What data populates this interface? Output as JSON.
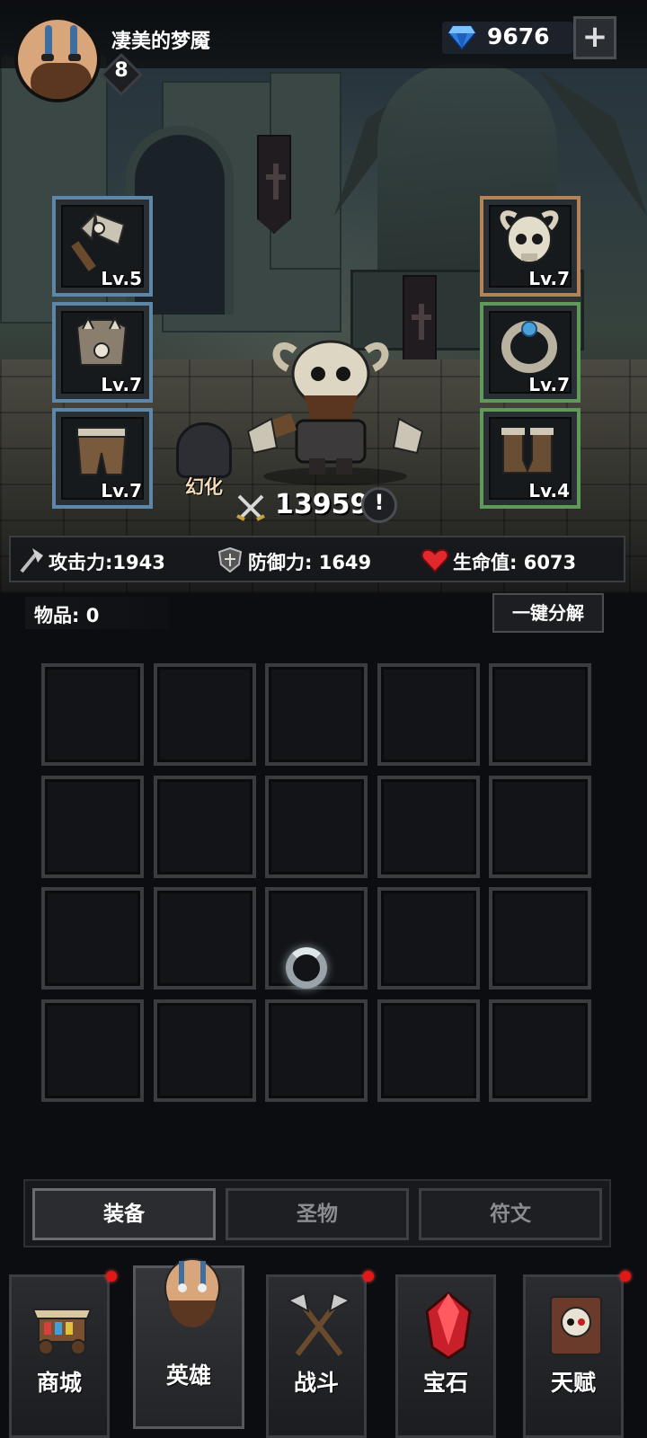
{
  "player": {
    "name": "凄美的梦魇",
    "level": "8",
    "gems": "9676"
  },
  "equipment": {
    "left": [
      {
        "name": "axe",
        "level": "Lv.5"
      },
      {
        "name": "chest-armor",
        "level": "Lv.7"
      },
      {
        "name": "leg-armor",
        "level": "Lv.7"
      }
    ],
    "right": [
      {
        "name": "skull-helmet",
        "level": "Lv.7"
      },
      {
        "name": "ring",
        "level": "Lv.7"
      },
      {
        "name": "boots",
        "level": "Lv.4"
      }
    ]
  },
  "hero": {
    "transform_label": "幻化",
    "power": "13959",
    "info_symbol": "!"
  },
  "stats": {
    "attack": "攻击力:1943",
    "defense": "防御力: 1649",
    "hp": "生命值: 6073"
  },
  "inventory": {
    "count_label": "物品: 0",
    "decompose_label": "一键分解",
    "rows": 4,
    "cols": 5
  },
  "tabs": {
    "items": [
      {
        "label": "装备",
        "active": true
      },
      {
        "label": "圣物",
        "active": false
      },
      {
        "label": "符文",
        "active": false
      }
    ]
  },
  "nav": {
    "items": [
      {
        "label": "商城",
        "icon": "shop-cart-icon",
        "badge": true
      },
      {
        "label": "英雄",
        "icon": "hero-portrait-icon",
        "badge": false,
        "active": true
      },
      {
        "label": "战斗",
        "icon": "crossed-axes-icon",
        "badge": true
      },
      {
        "label": "宝石",
        "icon": "red-gem-icon",
        "badge": false
      },
      {
        "label": "天赋",
        "icon": "skull-book-icon",
        "badge": true
      }
    ]
  },
  "colors": {
    "slot_blue": "#5d86a8",
    "slot_orange": "#b5835a",
    "slot_green": "#5f9a5a",
    "badge_red": "#e01818"
  }
}
